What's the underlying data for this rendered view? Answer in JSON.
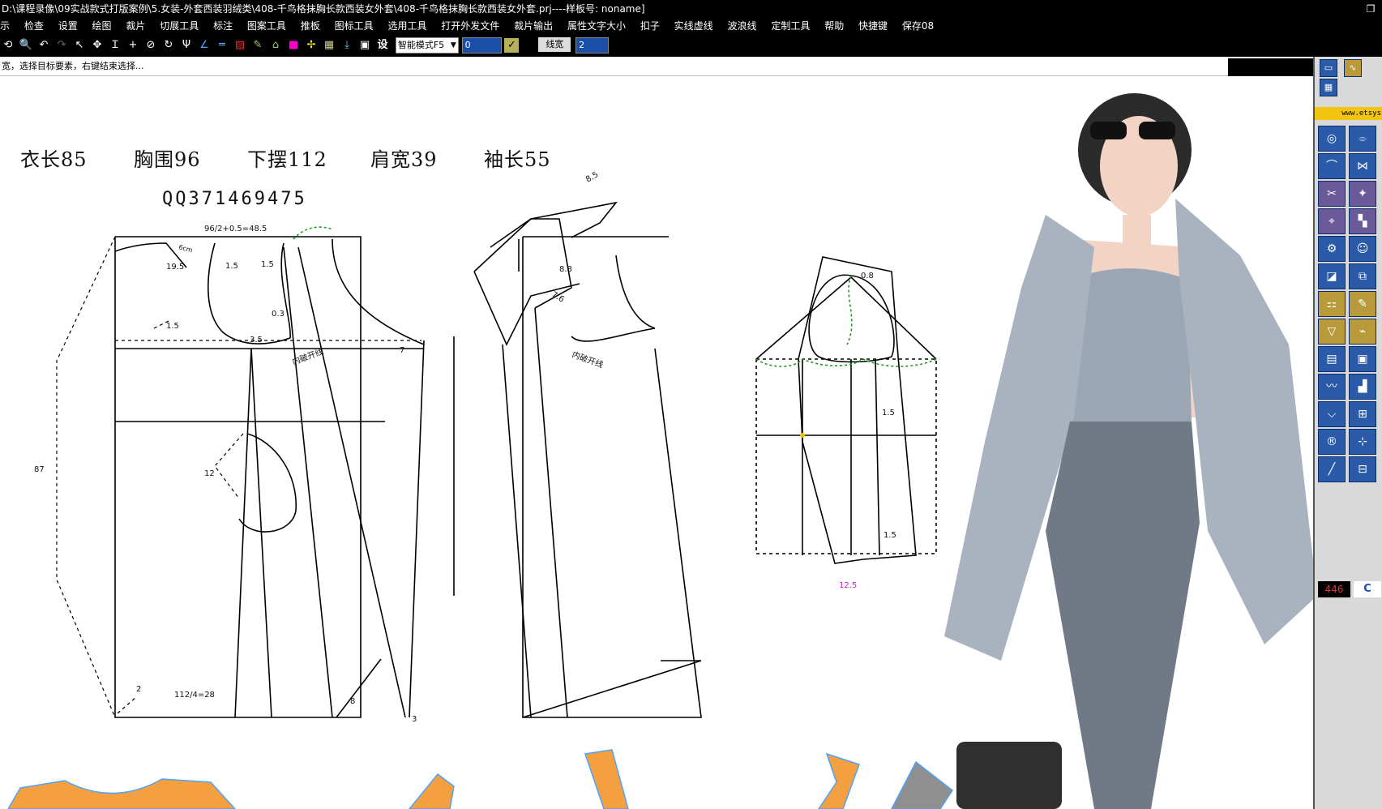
{
  "window": {
    "title": "D:\\课程录像\\09实战款式打版案例\\5.女装-外套西装羽绒类\\408-千鸟格抹胸长款西装女外套\\408-千鸟格抹胸长款西装女外套.prj----样板号: noname]",
    "restore_glyph": "❐"
  },
  "menu": [
    "示",
    "检查",
    "设置",
    "绘图",
    "裁片",
    "切展工具",
    "标注",
    "图案工具",
    "推板",
    "图标工具",
    "选用工具",
    "打开外发文件",
    "裁片输出",
    "属性文字大小",
    "扣子",
    "实线虚线",
    "波浪线",
    "定制工具",
    "帮助",
    "快捷键",
    "保存08"
  ],
  "toolbar": {
    "tools": [
      "rotate-tool",
      "zoom-tool",
      "undo-tool",
      "redo-tool",
      "select-tool",
      "move-tool",
      "align-tool",
      "cross-tool",
      "measure-tool",
      "rotate2-tool",
      "fork-tool",
      "angle-tool",
      "parallel-tool",
      "hatch-tool",
      "pen-tool",
      "compass-tool",
      "color-tool",
      "arrow-tool",
      "fill-tool",
      "drop-tool",
      "frame-tool",
      "settings-tool"
    ],
    "tool_glyphs": [
      "⟲",
      "🔍",
      "↶",
      "↷",
      "↖",
      "✥",
      "Ɪ",
      "+",
      "⊘",
      "↻",
      "Ψ",
      "∠",
      "═",
      "▨",
      "✎",
      "⌂",
      "■",
      "✢",
      "▦",
      "⤓",
      "▣",
      "设"
    ],
    "mode_select": "智能模式F5",
    "value_input": "0",
    "line_width_label": "线宽",
    "line_width_value": "2"
  },
  "status": {
    "prompt": "宽，选择目标要素，右键结束选择..."
  },
  "drawing": {
    "measurements": [
      "衣长85",
      "胸围96",
      "下摆112",
      "肩宽39",
      "袖长55"
    ],
    "qq": "QQ371469475",
    "labels": {
      "bust_formula": "96/2+0.5=48.5",
      "neck_depth": "19.5",
      "shoulder_a": "1.5",
      "shoulder_b": "1.5",
      "armhole_a": "0.3",
      "armhole_b": "3.5",
      "side_a": "1.5",
      "left_total": "87",
      "pocket": "12",
      "hem_formula": "112/4=28",
      "hem_left": "2",
      "hem_right": "8",
      "hem_end": "3",
      "seam_text_a": "内破开线",
      "seam_text_b": "内破开线",
      "front_seven": "7",
      "lapel_a": "8.5",
      "lapel_b": "8.8",
      "lapel_c": "7.6",
      "sleeve_top": "0.8",
      "sleeve_mid": "1.5",
      "sleeve_low": "1.5",
      "sleeve_cuff": "12.5",
      "collar_note": "6cm"
    }
  },
  "right_panel": {
    "url": "www.etsys",
    "counter": "446",
    "counter_right": "C"
  }
}
